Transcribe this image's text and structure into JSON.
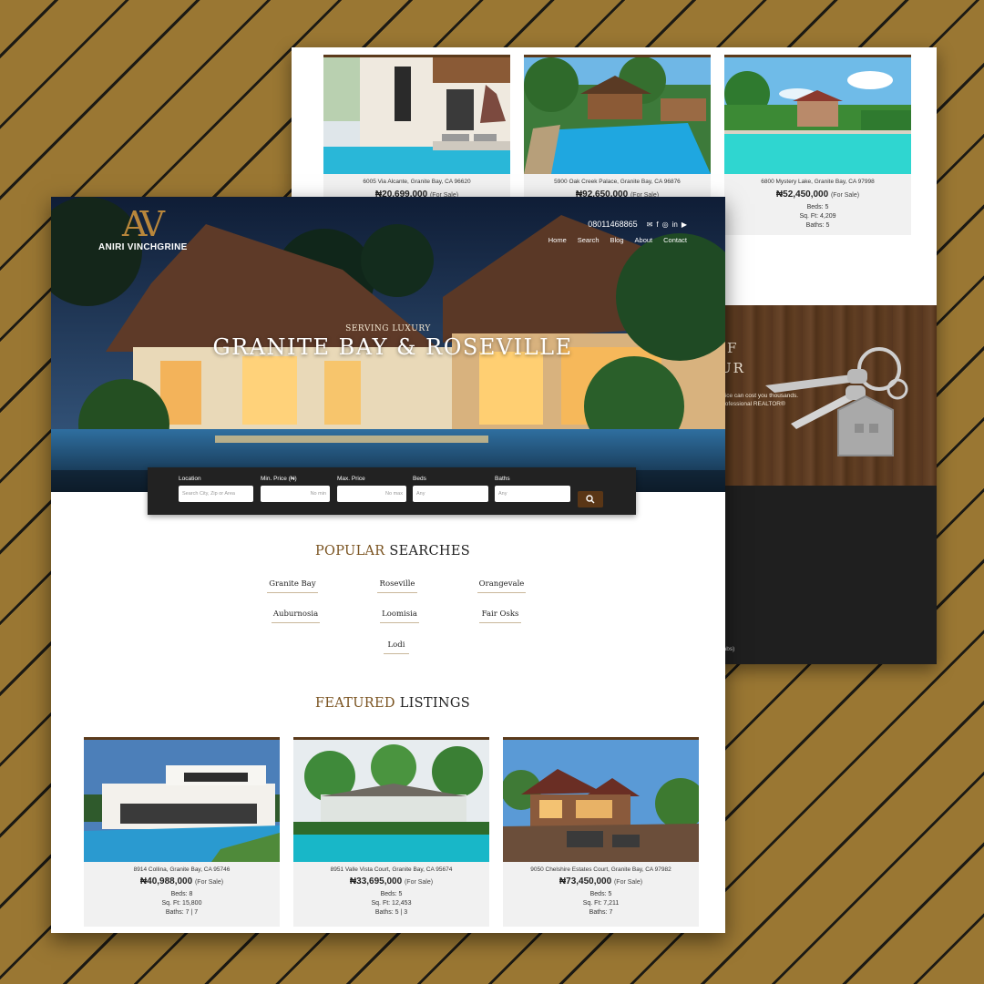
{
  "colors": {
    "background": "#9a7733",
    "accent": "#7a5320",
    "dark": "#222222",
    "card": "#f1f1f1"
  },
  "back_sheet": {
    "listings": [
      {
        "address": "6005 Via Alcante, Granite Bay, CA 96620",
        "price": "₦20,699,000",
        "status": "(For Sale)",
        "beds": "",
        "sqft": "",
        "baths": ""
      },
      {
        "address": "5900 Oak Creek Palace, Granite Bay, CA 96876",
        "price": "₦92,650,000",
        "status": "(For Sale)",
        "beds": "",
        "sqft": "",
        "baths": ""
      },
      {
        "address": "6800 Mystery Lake, Granite Bay, CA 97998",
        "price": "₦52,450,000",
        "status": "(For Sale)",
        "beds": "Beds: 5",
        "sqft": "Sq. Ft: 4,209",
        "baths": "Baths: 5"
      }
    ],
    "wood_heading_1": "F",
    "wood_heading_2": "UR",
    "wood_text_1": "price can cost you thousands.",
    "wood_text_2": "professional REALTOR®",
    "credit": "Labs)"
  },
  "header": {
    "brand_mark": "AV",
    "brand_name": "ANIRI VINCHGRINE",
    "phone": "08011468865",
    "social_icons": [
      "mail-icon",
      "facebook-icon",
      "instagram-icon",
      "linkedin-icon",
      "youtube-icon"
    ],
    "nav": [
      "Home",
      "Search",
      "Blog",
      "About",
      "Contact"
    ]
  },
  "hero": {
    "tagline": "SERVING LUXURY",
    "headline": "GRANITE BAY & ROSEVILLE"
  },
  "search": {
    "location_label": "Location",
    "location_placeholder": "Search City, Zip or Area",
    "min_label": "Min. Price (₦)",
    "min_placeholder": "No min",
    "max_label": "Max. Price",
    "max_placeholder": "No max",
    "beds_label": "Beds",
    "beds_placeholder": "Any",
    "baths_label": "Baths",
    "baths_placeholder": "Any",
    "button_icon": "search-icon"
  },
  "popular": {
    "title_accent": "POPULAR",
    "title_rest": "SEARCHES",
    "items": [
      "Granite Bay",
      "Roseville",
      "Orangevale",
      "Auburnosia",
      "Loomisia",
      "Fair Osks",
      "Lodi"
    ]
  },
  "featured": {
    "title_accent": "FEATURED",
    "title_rest": "LISTINGS",
    "listings": [
      {
        "address": "8914 Collina, Granite Bay, CA 95746",
        "price": "₦40,988,000",
        "status": "(For Sale)",
        "beds": "Beds: 8",
        "sqft": "Sq. Ft: 15,800",
        "baths": "Baths: 7 | 7"
      },
      {
        "address": "8951 Valle Vista Court, Granite Bay, CA 95674",
        "price": "₦33,695,000",
        "status": "(For Sale)",
        "beds": "Beds: 5",
        "sqft": "Sq. Ft: 12,453",
        "baths": "Baths: 5 | 3"
      },
      {
        "address": "9050 Chelshire Estates Court, Granite Bay, CA 97982",
        "price": "₦73,450,000",
        "status": "(For Sale)",
        "beds": "Beds: 5",
        "sqft": "Sq. Ft: 7,211",
        "baths": "Baths: 7"
      }
    ]
  }
}
